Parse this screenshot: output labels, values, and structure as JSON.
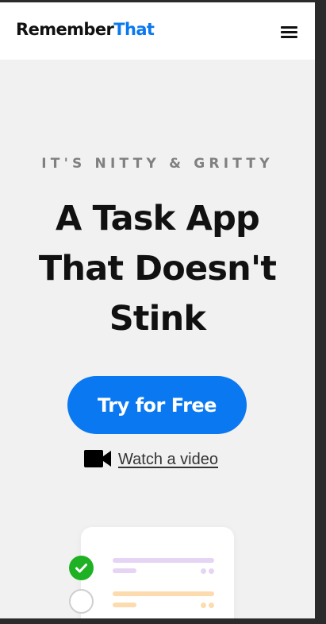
{
  "header": {
    "logo_primary": "Remember",
    "logo_accent": "That",
    "menu_icon": "hamburger-menu-icon"
  },
  "hero": {
    "eyebrow": "IT'S NITTY & GRITTY",
    "headline_lines": [
      "A Task App",
      "That Doesn't",
      "Stink"
    ],
    "cta_label": "Try for Free",
    "video_icon": "video-camera-icon",
    "video_link_label": "Watch a video"
  },
  "preview": {
    "tasks": [
      {
        "state": "done",
        "icon": "checkmark-icon",
        "bar_color": "#e6d4f4"
      },
      {
        "state": "todo",
        "icon": "empty-circle-icon",
        "bar_color": "#fcdcae"
      }
    ]
  },
  "colors": {
    "brand": "#0a78f0",
    "page_bg": "#f1f1f1",
    "headline": "#111111",
    "eyebrow": "#808080",
    "check_done": "#1fb124",
    "purple_bar": "#e6d4f4",
    "orange_bar": "#fcdcae"
  }
}
